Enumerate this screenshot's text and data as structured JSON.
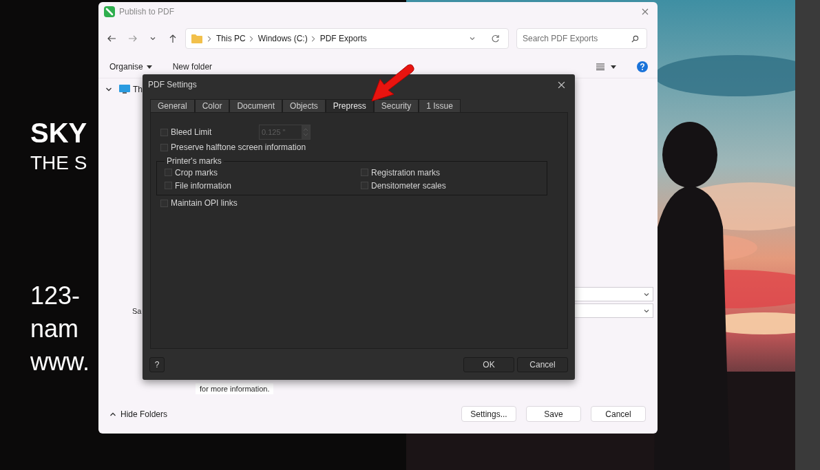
{
  "background_document": {
    "headline": {
      "title": "SKY",
      "tagline": "THE S"
    },
    "contacts": [
      "123-",
      "nam",
      "www."
    ],
    "photo": {
      "kind": "picture"
    }
  },
  "publish_dialog": {
    "title": "Publish to PDF",
    "address": {
      "segments": [
        "This PC",
        "Windows (C:)",
        "PDF Exports"
      ]
    },
    "search": {
      "placeholder": "Search PDF Exports"
    },
    "commands": [
      {
        "label": "Organise",
        "menu": true
      },
      {
        "label": "New folder",
        "menu": false
      }
    ],
    "tree": [
      {
        "label": "Th",
        "expanded": true
      }
    ],
    "save_label": "Sa",
    "info_text": "for more information.",
    "hide_folders": "Hide Folders",
    "buttons": [
      "Settings...",
      "Save",
      "Cancel"
    ]
  },
  "pdf_settings": {
    "title": "PDF Settings",
    "tabs": [
      {
        "label": "General",
        "selected": false
      },
      {
        "label": "Color",
        "selected": false
      },
      {
        "label": "Document",
        "selected": false
      },
      {
        "label": "Objects",
        "selected": false
      },
      {
        "label": "Prepress",
        "selected": true
      },
      {
        "label": "Security",
        "selected": false
      },
      {
        "label": "1 Issue",
        "selected": false
      }
    ],
    "options": [
      {
        "kind": "checkbox-with-field",
        "label": "Bleed Limit",
        "checked": false,
        "value": "0.125 \"",
        "disabled": true
      },
      {
        "kind": "checkbox",
        "label": "Preserve halftone screen information",
        "checked": false
      },
      {
        "kind": "group"
      },
      {
        "kind": "checkbox",
        "label": "Maintain OPI links",
        "checked": false
      }
    ],
    "printers_marks": {
      "title": "Printer's marks",
      "options": [
        {
          "label": "Crop marks",
          "checked": false
        },
        {
          "label": "Registration marks",
          "checked": false
        },
        {
          "label": "File information",
          "checked": false
        },
        {
          "label": "Densitometer scales",
          "checked": false
        }
      ]
    },
    "help": "?",
    "buttons": [
      "OK",
      "Cancel"
    ]
  }
}
